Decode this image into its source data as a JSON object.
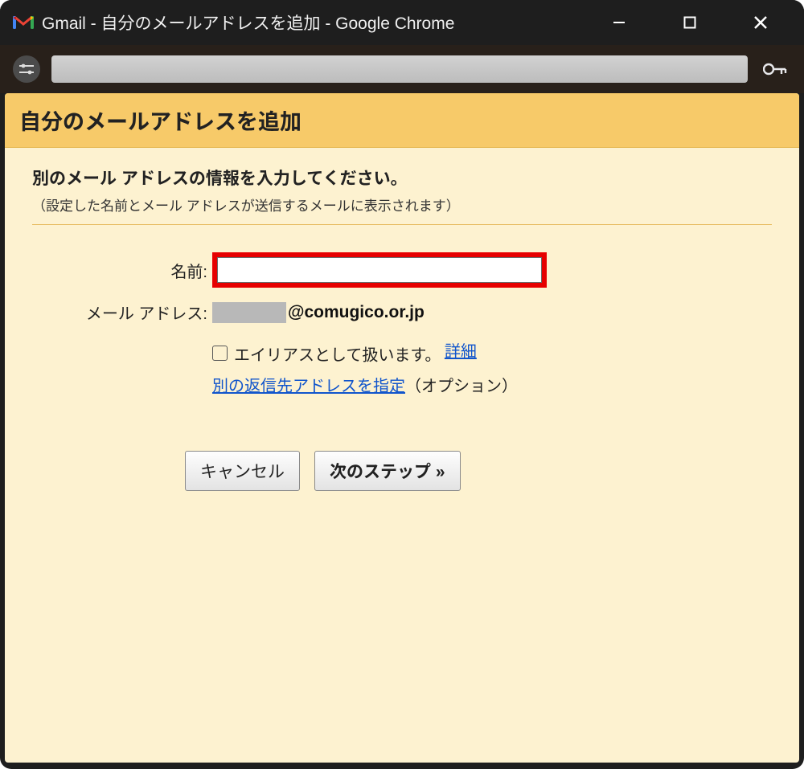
{
  "window": {
    "title": "Gmail - 自分のメールアドレスを追加 - Google Chrome"
  },
  "header": {
    "title": "自分のメールアドレスを追加"
  },
  "section": {
    "heading": "別のメール アドレスの情報を入力してください。",
    "subtext": "（設定した名前とメール アドレスが送信するメールに表示されます）"
  },
  "form": {
    "nameLabel": "名前:",
    "nameValue": "",
    "emailLabel": "メール アドレス:",
    "emailDomain": "@comugico.or.jp",
    "aliasLabel": "エイリアスとして扱います。",
    "aliasDetailLink": "詳細",
    "altReplyLink": "別の返信先アドレスを指定",
    "optionText": "（オプション）"
  },
  "buttons": {
    "cancel": "キャンセル",
    "next": "次のステップ »"
  }
}
